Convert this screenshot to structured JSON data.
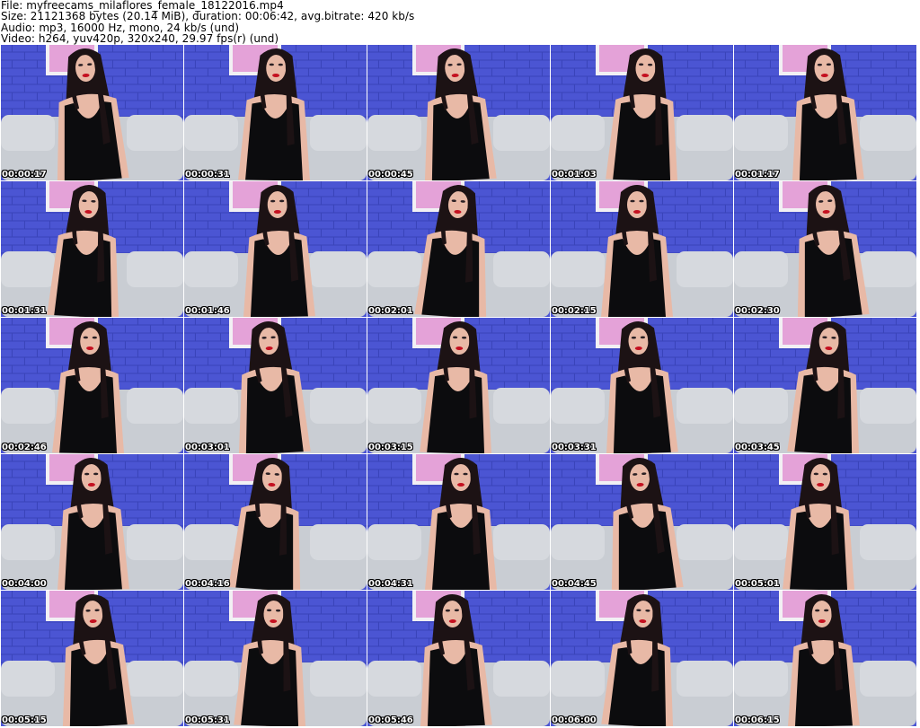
{
  "header": {
    "file_line": "File: myfreecams_milaflores_female_18122016.mp4",
    "size_line": "Size: 21121368 bytes (20.14 MiB), duration: 00:06:42, avg.bitrate: 420 kb/s",
    "audio_line": "Audio: mp3, 16000 Hz, mono, 24 kb/s (und)",
    "video_line": "Video: h264, yuv420p, 320x240, 29.97 fps(r) (und)"
  },
  "colors": {
    "wall": "#4b55d3",
    "brick_line": "#3a44b8",
    "sofa": "#c9cdd3",
    "dress": "#0c0c0e",
    "hair": "#1c1214",
    "skin": "#e8b9a6",
    "lips": "#c41020",
    "poster": "#e4a2d8",
    "timestamp_text": "#ffffff"
  },
  "thumbnails": [
    {
      "timestamp": "00:00:17"
    },
    {
      "timestamp": "00:00:31"
    },
    {
      "timestamp": "00:00:45"
    },
    {
      "timestamp": "00:01:03"
    },
    {
      "timestamp": "00:01:17"
    },
    {
      "timestamp": "00:01:31"
    },
    {
      "timestamp": "00:01:46"
    },
    {
      "timestamp": "00:02:01"
    },
    {
      "timestamp": "00:02:15"
    },
    {
      "timestamp": "00:02:30"
    },
    {
      "timestamp": "00:02:46"
    },
    {
      "timestamp": "00:03:01"
    },
    {
      "timestamp": "00:03:15"
    },
    {
      "timestamp": "00:03:31"
    },
    {
      "timestamp": "00:03:45"
    },
    {
      "timestamp": "00:04:00"
    },
    {
      "timestamp": "00:04:16"
    },
    {
      "timestamp": "00:04:31"
    },
    {
      "timestamp": "00:04:45"
    },
    {
      "timestamp": "00:05:01"
    },
    {
      "timestamp": "00:05:15"
    },
    {
      "timestamp": "00:05:31"
    },
    {
      "timestamp": "00:05:46"
    },
    {
      "timestamp": "00:06:00"
    },
    {
      "timestamp": "00:06:15"
    }
  ]
}
